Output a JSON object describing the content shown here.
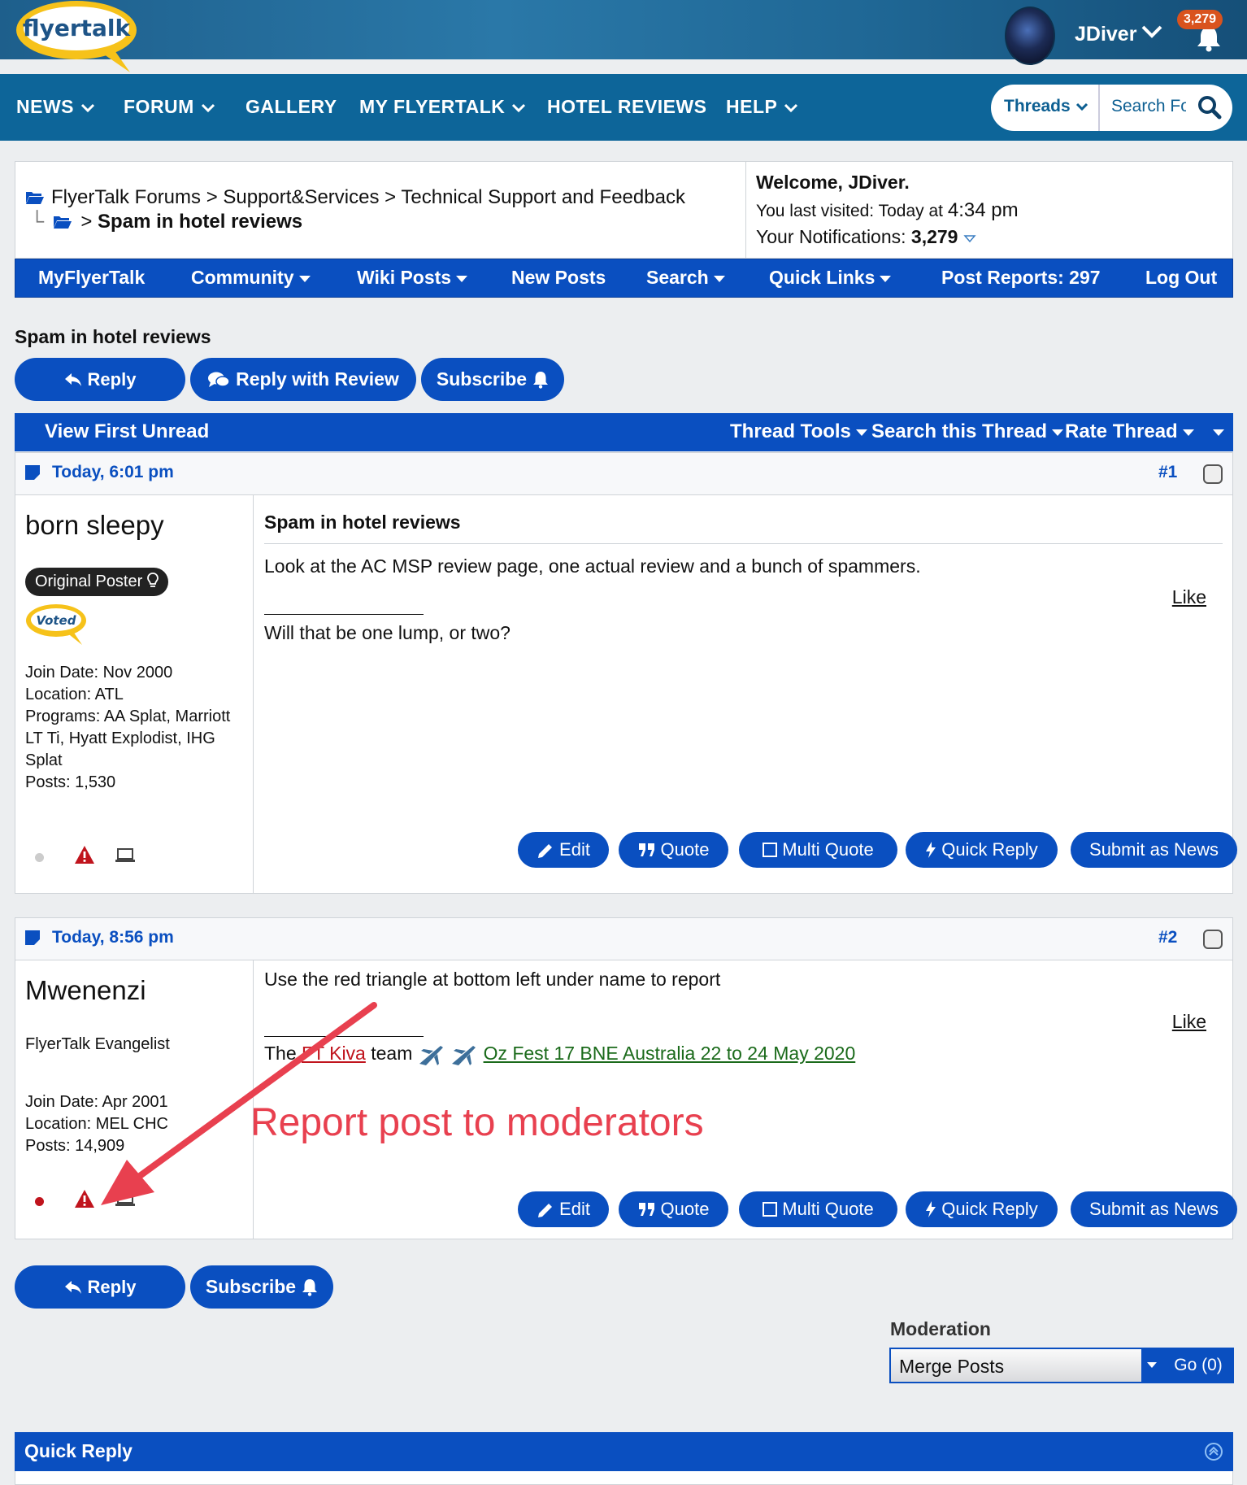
{
  "header": {
    "logo_text": "flyertalk",
    "username": "JDiver",
    "notification_count": "3,279"
  },
  "mainnav": {
    "items": [
      "NEWS",
      "FORUM",
      "GALLERY",
      "MY FLYERTALK",
      "HOTEL REVIEWS",
      "HELP"
    ],
    "search_scope": "Threads",
    "search_placeholder": "Search Forums"
  },
  "breadcrumb": {
    "path": "FlyerTalk Forums > Support&Services > Technical Support and Feedback",
    "sep": ">",
    "current": "Spam in hotel reviews"
  },
  "welcome": {
    "greeting": "Welcome, JDiver.",
    "last_visited_label": "You last visited: Today at",
    "last_visited_time": "4:34 pm",
    "notifications_label": "Your Notifications:",
    "notifications_count": "3,279"
  },
  "forumnav": {
    "myflyertalk": "MyFlyerTalk",
    "community": "Community",
    "wiki_posts": "Wiki Posts",
    "new_posts": "New Posts",
    "search": "Search",
    "quick_links": "Quick Links",
    "post_reports": "Post Reports: 297",
    "log_out": "Log Out"
  },
  "thread": {
    "title": "Spam in hotel reviews",
    "reply": "Reply",
    "reply_with_review": "Reply with Review",
    "subscribe": "Subscribe"
  },
  "toolbar": {
    "view_first_unread": "View First Unread",
    "thread_tools": "Thread Tools",
    "search_thread": "Search this Thread",
    "rate_thread": "Rate Thread"
  },
  "post_actions": {
    "edit": "Edit",
    "quote": "Quote",
    "multi_quote": "Multi Quote",
    "quick_reply": "Quick Reply",
    "submit_news": "Submit as News",
    "like": "Like"
  },
  "posts": [
    {
      "date": "Today, 6:01 pm",
      "number": "#1",
      "author": "born sleepy",
      "badge": "Original Poster",
      "voted_badge": "Voted",
      "join_date": "Join Date: Nov 2000",
      "location": "Location: ATL",
      "programs": "Programs: AA Splat, Marriott LT Ti, Hyatt Explodist, IHG Splat",
      "posts": "Posts: 1,530",
      "title": "Spam in hotel reviews",
      "body": "Look at the AC MSP review page, one actual review and a bunch of spammers.",
      "signature": "Will that be one lump, or two?"
    },
    {
      "date": "Today, 8:56 pm",
      "number": "#2",
      "author": "Mwenenzi",
      "user_title": "FlyerTalk Evangelist",
      "join_date": "Join Date: Apr 2001",
      "location": "Location: MEL CHC",
      "posts": "Posts: 14,909",
      "body": "Use the red triangle at bottom left under name to report",
      "sig_pre": "The",
      "sig_link": "FT Kiva",
      "sig_mid": "team",
      "sig_event": "Oz Fest 17 BNE Australia 22 to 24 May 2020"
    }
  ],
  "annotation": "Report post to moderators",
  "bottom": {
    "reply": "Reply",
    "subscribe": "Subscribe"
  },
  "moderation": {
    "label": "Moderation",
    "selected": "Merge Posts",
    "go": "Go (0)"
  },
  "quick_reply": {
    "title": "Quick Reply"
  },
  "colors": {
    "primary_blue": "#0a4fc0",
    "nav_teal": "#0d6599",
    "annotation_red": "#e8404f",
    "notif_orange": "#d9531e"
  }
}
